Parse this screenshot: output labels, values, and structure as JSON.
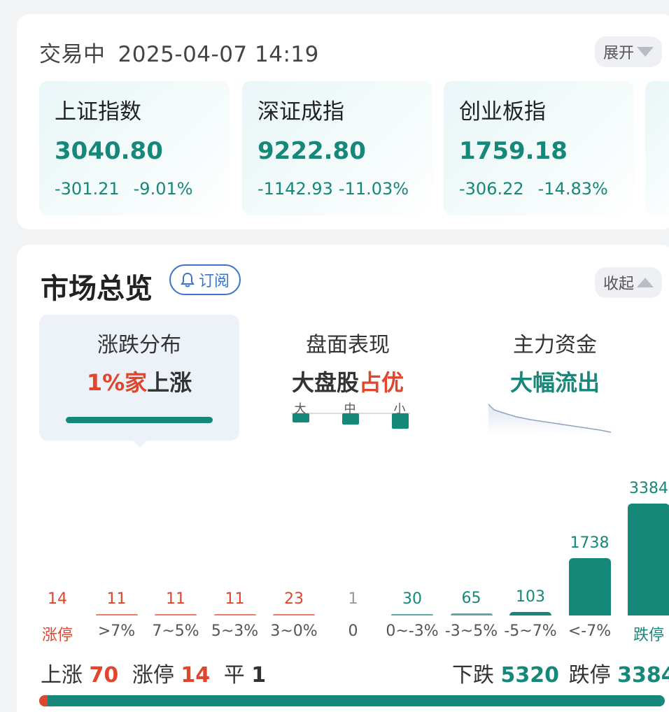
{
  "status": {
    "state": "交易中",
    "datetime": "2025-04-07 14:19"
  },
  "expand_label": "展开",
  "indices": [
    {
      "name": "上证指数",
      "value": "3040.80",
      "change": "-301.21",
      "pct": "-9.01%"
    },
    {
      "name": "深证成指",
      "value": "9222.80",
      "change": "-1142.93",
      "pct": "-11.03%"
    },
    {
      "name": "创业板指",
      "value": "1759.18",
      "change": "-306.22",
      "pct": "-14.83%"
    }
  ],
  "overview": {
    "title": "市场总览",
    "subscribe_label": "订阅",
    "collapse_label": "收起",
    "tabs": [
      {
        "title": "涨跌分布",
        "value_prefix": "1%家",
        "value_suffix": "上涨"
      },
      {
        "title": "盘面表现",
        "value_prefix": "大盘股",
        "value_suffix": "占优",
        "caps": [
          {
            "label": "大",
            "level": 0.45
          },
          {
            "label": "中",
            "level": 0.65
          },
          {
            "label": "小",
            "level": 1.0
          }
        ]
      },
      {
        "title": "主力资金",
        "value": "大幅流出"
      }
    ]
  },
  "chart_data": {
    "type": "bar",
    "categories": [
      "涨停",
      ">7%",
      "7~5%",
      "5~3%",
      "3~0%",
      "0",
      "0~-3%",
      "-3~5%",
      "-5~7%",
      "<-7%",
      "跌停"
    ],
    "values": [
      14,
      11,
      11,
      11,
      23,
      1,
      30,
      65,
      103,
      1738,
      3384
    ],
    "colors": [
      "#e0452e",
      "#e0452e",
      "#e0452e",
      "#e0452e",
      "#e0452e",
      "#999999",
      "#16887a",
      "#16887a",
      "#16887a",
      "#16887a",
      "#16887a"
    ],
    "ylim": [
      0,
      3384
    ]
  },
  "summary": {
    "up_label": "上涨",
    "up_value": "70",
    "limit_up_label": "涨停",
    "limit_up_value": "14",
    "flat_label": "平",
    "flat_value": "1",
    "down_label": "下跌",
    "down_value": "5320",
    "limit_down_label": "跌停",
    "limit_down_value": "3384",
    "up_fraction": 0.013
  },
  "colors": {
    "up": "#e0452e",
    "down": "#16887a",
    "flat": "#999999"
  }
}
